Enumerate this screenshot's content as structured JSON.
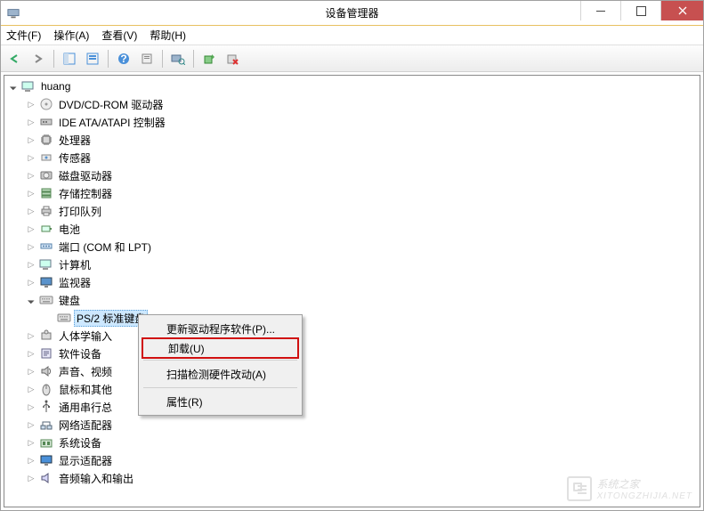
{
  "title": "设备管理器",
  "menu": {
    "file": "文件(F)",
    "action": "操作(A)",
    "view": "查看(V)",
    "help": "帮助(H)"
  },
  "root": "huang",
  "categories": [
    {
      "icon": "disc",
      "label": "DVD/CD-ROM 驱动器"
    },
    {
      "icon": "ide",
      "label": "IDE ATA/ATAPI 控制器"
    },
    {
      "icon": "cpu",
      "label": "处理器"
    },
    {
      "icon": "sensor",
      "label": "传感器"
    },
    {
      "icon": "disk",
      "label": "磁盘驱动器"
    },
    {
      "icon": "storage",
      "label": "存储控制器"
    },
    {
      "icon": "printer",
      "label": "打印队列"
    },
    {
      "icon": "battery",
      "label": "电池"
    },
    {
      "icon": "port",
      "label": "端口 (COM 和 LPT)"
    },
    {
      "icon": "computer",
      "label": "计算机"
    },
    {
      "icon": "monitor",
      "label": "监视器"
    }
  ],
  "keyboard_cat": "键盘",
  "keyboard_item": "PS/2 标准键盘",
  "categories2": [
    {
      "icon": "hid",
      "label": "人体学输入"
    },
    {
      "icon": "sw",
      "label": "软件设备"
    },
    {
      "icon": "audio",
      "label": "声音、视频"
    },
    {
      "icon": "mouse",
      "label": "鼠标和其他"
    },
    {
      "icon": "usb",
      "label": "通用串行总"
    },
    {
      "icon": "net",
      "label": "网络适配器"
    },
    {
      "icon": "system",
      "label": "系统设备"
    },
    {
      "icon": "display",
      "label": "显示适配器"
    },
    {
      "icon": "audioio",
      "label": "音频输入和输出"
    }
  ],
  "context_menu": {
    "update": "更新驱动程序软件(P)...",
    "uninstall": "卸载(U)",
    "scan": "扫描检测硬件改动(A)",
    "properties": "属性(R)"
  },
  "watermark": {
    "main": "系统之家",
    "sub": "XITONGZHIJIA.NET"
  }
}
